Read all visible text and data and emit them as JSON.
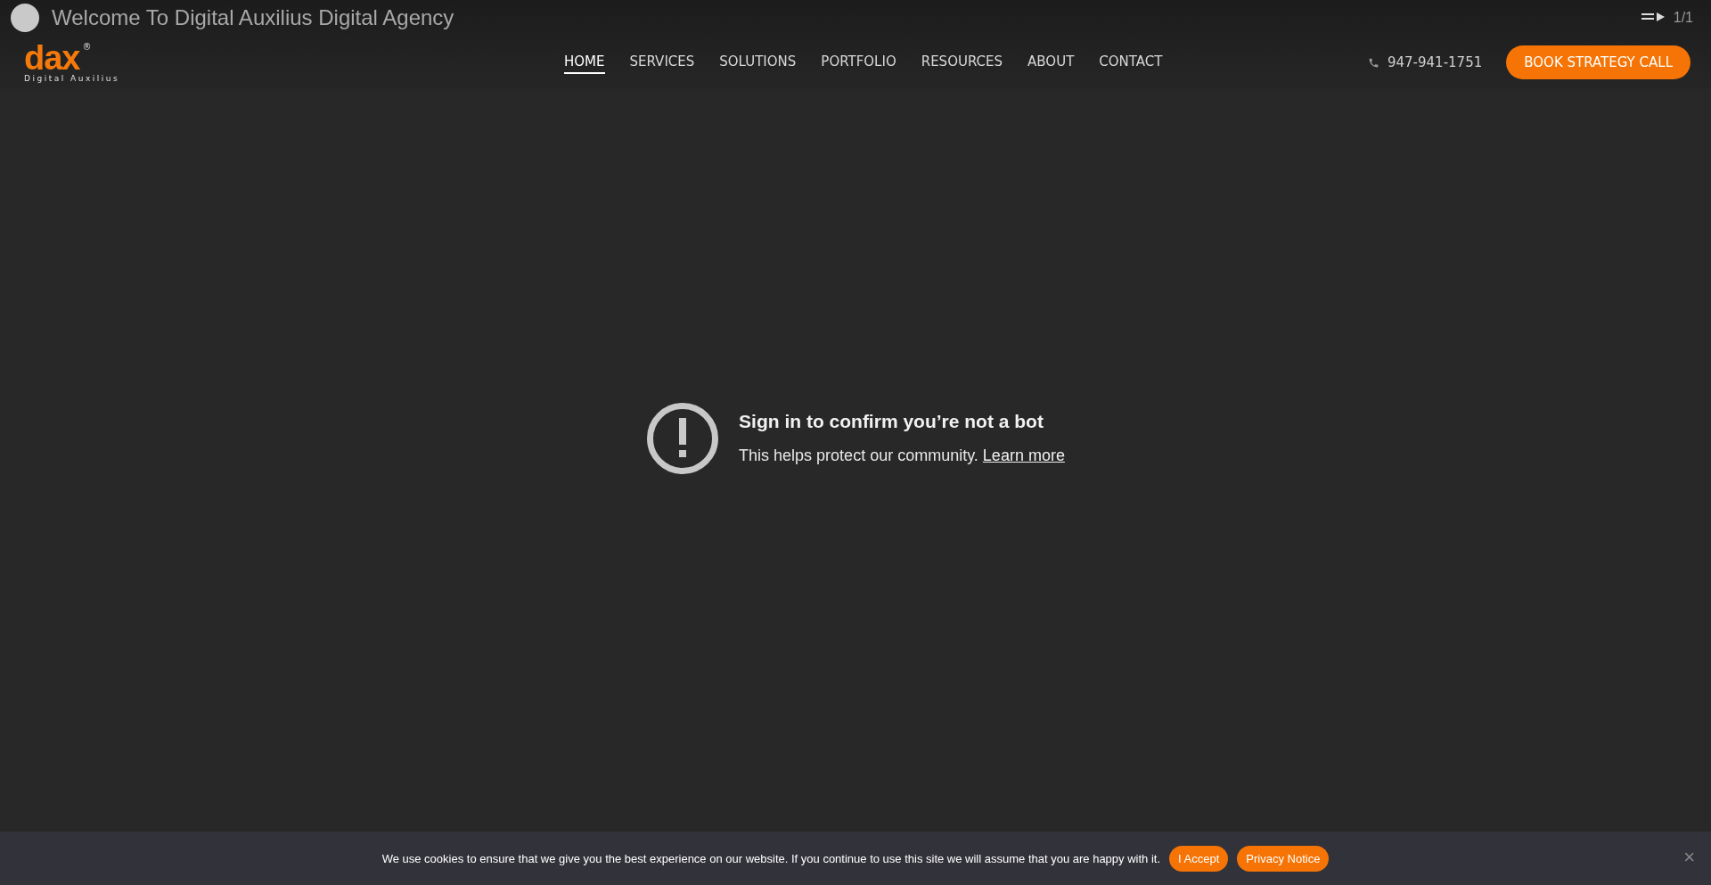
{
  "video": {
    "title": "Welcome To Digital Auxilius Digital Agency",
    "playlist_count": "1/1",
    "error_title": "Sign in to confirm you’re not a bot",
    "error_text": "This helps protect our community.",
    "error_link": "Learn more"
  },
  "header": {
    "logo_text": "dax",
    "logo_registered": "®",
    "logo_tagline": "Digital Auxilius",
    "nav": [
      {
        "label": "HOME",
        "selected": true
      },
      {
        "label": "SERVICES",
        "selected": false
      },
      {
        "label": "SOLUTIONS",
        "selected": false
      },
      {
        "label": "PORTFOLIO",
        "selected": false
      },
      {
        "label": "RESOURCES",
        "selected": false
      },
      {
        "label": "ABOUT",
        "selected": false
      },
      {
        "label": "CONTACT",
        "selected": false
      }
    ],
    "phone": "947-941-1751",
    "cta": "BOOK STRATEGY CALL"
  },
  "cookie_bar": {
    "text": "We use cookies to ensure that we give you the best experience on our website. If you continue to use this site we will assume that you are happy with it.",
    "buttons": [
      "I Accept",
      "Privacy Notice"
    ],
    "close": "×"
  }
}
